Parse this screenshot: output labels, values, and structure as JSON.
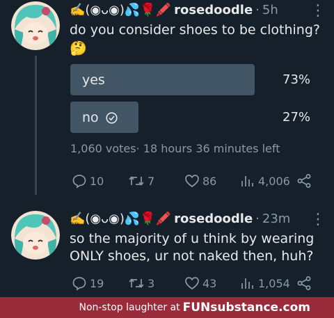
{
  "colors": {
    "background": "#15202b",
    "poll_bar": "#415564",
    "muted": "#8b98a5",
    "footer": "#9a2b3a"
  },
  "tweets": [
    {
      "display_name": "✍️(◉ᴗ◉)💦🌹🖍️",
      "username": "rosedoodle",
      "time": "5h",
      "text": "do you consider shoes to be clothing?",
      "emoji": "🤔",
      "poll": {
        "options": [
          {
            "label": "yes",
            "percent": "73%",
            "value": 73
          },
          {
            "label": "no",
            "percent": "27%",
            "value": 27,
            "selected": true
          }
        ],
        "votes": "1,060 votes",
        "time_left": "18 hours 36 minutes left"
      },
      "actions": {
        "replies": "10",
        "retweets": "7",
        "likes": "86",
        "views": "4,006"
      }
    },
    {
      "display_name": "✍️(◉ᴗ◉)💦🌹🖍️",
      "username": "rosedoodle",
      "time": "23m",
      "text_line1": "so the majority of u think by wearing",
      "text_line2": "ONLY shoes, ur not naked then, huh?",
      "actions": {
        "replies": "19",
        "retweets": "3",
        "likes": "43",
        "views": "1,054"
      }
    }
  ],
  "footer": {
    "prefix": "Non-stop laughter at",
    "brand": "FUNsubstance.com"
  }
}
